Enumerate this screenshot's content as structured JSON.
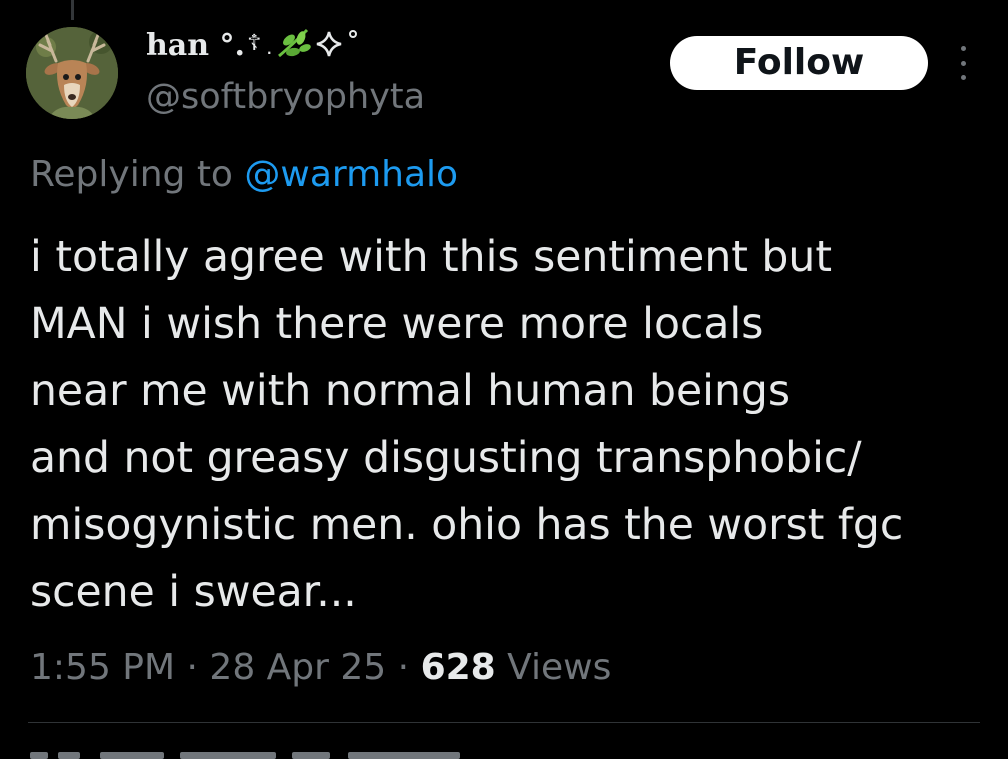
{
  "tweet": {
    "author": {
      "display_name": "han °.☦ ✧°",
      "display_name_text": "han °.",
      "handle": "@softbryophyta",
      "avatar_icon": "deer-avatar-icon"
    },
    "follow_label": "Follow",
    "more_icon": "more-vertical-icon",
    "reply": {
      "prefix": "Replying to ",
      "to_handle": "@warmhalo"
    },
    "text": "i totally agree with this sentiment but\nMAN i wish there were more locals\nnear me with normal human beings\nand not greasy disgusting transphobic/\nmisogynistic men. ohio has the worst fgc\nscene i swear...",
    "time": "1:55 PM",
    "separator": "·",
    "date": "28 Apr 25",
    "views_count": "628",
    "views_label": " Views"
  },
  "colors": {
    "background": "#000000",
    "primary_text": "#e7e9ea",
    "secondary_text": "#71767b",
    "link": "#1d9bf0",
    "follow_bg": "#ffffff",
    "follow_text": "#0f1419",
    "divider": "#2f3336"
  }
}
